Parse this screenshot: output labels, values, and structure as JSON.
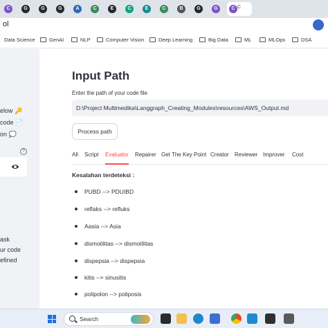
{
  "browser": {
    "tabs": [
      {
        "glyph": "C",
        "color": "#7a53c9"
      },
      {
        "glyph": "G",
        "color": "#24292e"
      },
      {
        "glyph": "G",
        "color": "#24292e"
      },
      {
        "glyph": "G",
        "color": "#24292e"
      },
      {
        "glyph": "A",
        "color": "#2b6cb0"
      },
      {
        "glyph": "C",
        "color": "#3a8a5c"
      },
      {
        "glyph": "E",
        "color": "#24292e"
      },
      {
        "glyph": "C",
        "color": "#10a37f"
      },
      {
        "glyph": "E",
        "color": "#1a8a8a"
      },
      {
        "glyph": "C",
        "color": "#3a8a5c"
      },
      {
        "glyph": "B",
        "color": "#555555"
      },
      {
        "glyph": "G",
        "color": "#24292e"
      },
      {
        "glyph": "G",
        "color": "#7a53c9"
      },
      {
        "glyph": "C",
        "color": "#7a53c9",
        "label": "C",
        "active": true
      }
    ],
    "address_fragment": "ol",
    "bookmarks": [
      "Data Science",
      "GenAI",
      "NLP",
      "Computer Vision",
      "Deep Learning",
      "Big Data",
      "ML",
      "MLOps",
      "DSA"
    ]
  },
  "sidebar": {
    "fragments": [
      "elow 🔑",
      "code 📄",
      "on 💭",
      "ask",
      "ur code",
      "efined"
    ],
    "help_glyph": "?"
  },
  "main": {
    "title": "Input Path",
    "field_label": "Enter the path of your code file",
    "path_value": "D:\\Project Multimedika\\Langgraph_Creating_Modules\\resources\\AWS_Output.md",
    "process_button": "Process path",
    "tabs": [
      "All",
      "Script",
      "Evaluator",
      "Repairer",
      "Get The Key Point",
      "Creator",
      "Reviewer",
      "Improver",
      "Cost"
    ],
    "selected_tab": "Evaluator",
    "section_heading": "Kesalahan terdeteksi :",
    "items": [
      "PUBD --> PDUIBD",
      "reflaks --> refluks",
      "Aasia --> Asia",
      "dismotilitas --> dismotilitas",
      "dispepsia --> dispepsia",
      "kitis --> sinusitis",
      "polipolon --> poliposis"
    ],
    "accent_color": "#ff4b4b"
  },
  "taskbar": {
    "search_placeholder": "Search"
  }
}
